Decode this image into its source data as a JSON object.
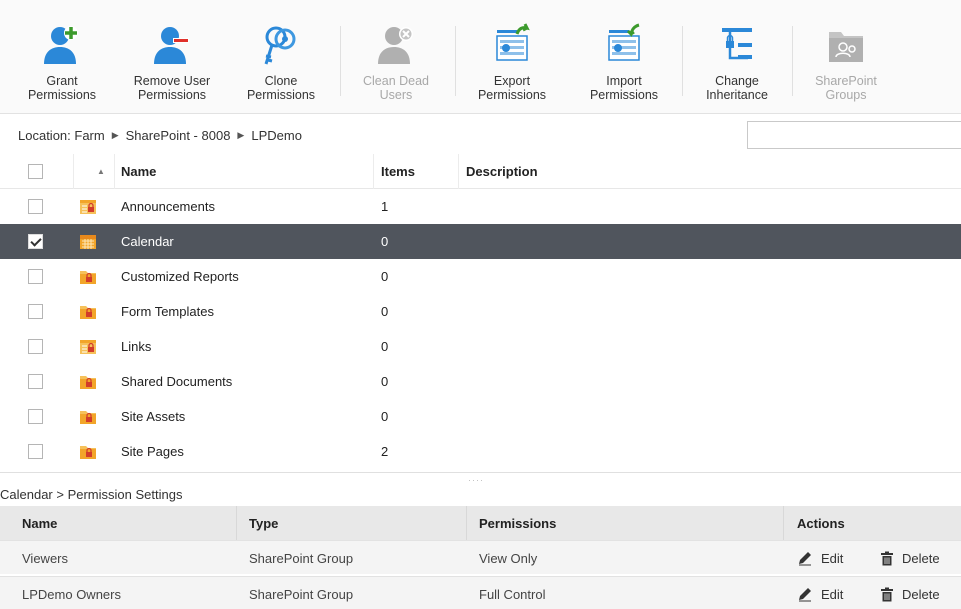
{
  "toolbar": {
    "buttons": [
      {
        "label": "Grant\nPermissions",
        "icon": "user-add-icon",
        "enabled": true
      },
      {
        "label": "Remove User\nPermissions",
        "icon": "user-remove-icon",
        "enabled": true
      },
      {
        "label": "Clone\nPermissions",
        "icon": "keys-icon",
        "enabled": true
      },
      {
        "label": "Clean Dead\nUsers",
        "icon": "user-clean-icon",
        "enabled": false
      },
      {
        "label": "Export\nPermissions",
        "icon": "export-icon",
        "enabled": true
      },
      {
        "label": "Import\nPermissions",
        "icon": "import-icon",
        "enabled": true
      },
      {
        "label": "Change\nInheritance",
        "icon": "inheritance-icon",
        "enabled": true
      },
      {
        "label": "SharePoint\nGroups",
        "icon": "sharepoint-groups-icon",
        "enabled": false
      }
    ]
  },
  "location": {
    "prefix": "Location: Farm",
    "crumbs": [
      "SharePoint - 8008",
      "LPDemo"
    ],
    "arrow": "▶"
  },
  "search": {
    "placeholder": "",
    "value": ""
  },
  "grid": {
    "sort_indicator": "▲",
    "columns": {
      "name": "Name",
      "items": "Items",
      "description": "Description"
    },
    "rows": [
      {
        "name": "Announcements",
        "items": "1",
        "description": "",
        "icon": "list-lock-icon",
        "checked": false,
        "selected": false
      },
      {
        "name": "Calendar",
        "items": "0",
        "description": "",
        "icon": "calendar-list-icon",
        "checked": true,
        "selected": true
      },
      {
        "name": "Customized Reports",
        "items": "0",
        "description": "",
        "icon": "library-lock-icon",
        "checked": false,
        "selected": false
      },
      {
        "name": "Form Templates",
        "items": "0",
        "description": "",
        "icon": "library-lock-icon",
        "checked": false,
        "selected": false
      },
      {
        "name": "Links",
        "items": "0",
        "description": "",
        "icon": "list-lock-icon",
        "checked": false,
        "selected": false
      },
      {
        "name": "Shared Documents",
        "items": "0",
        "description": "",
        "icon": "library-lock-icon",
        "checked": false,
        "selected": false
      },
      {
        "name": "Site Assets",
        "items": "0",
        "description": "",
        "icon": "library-lock-icon",
        "checked": false,
        "selected": false
      },
      {
        "name": "Site Pages",
        "items": "2",
        "description": "",
        "icon": "library-lock-icon",
        "checked": false,
        "selected": false
      }
    ]
  },
  "splitter": {
    "grip": "····"
  },
  "permissions": {
    "title": "Calendar > Permission Settings",
    "columns": {
      "name": "Name",
      "type": "Type",
      "permissions": "Permissions",
      "actions": "Actions"
    },
    "edit_label": "Edit",
    "delete_label": "Delete",
    "rows": [
      {
        "name": "Viewers",
        "type": "SharePoint Group",
        "permissions": "View Only"
      },
      {
        "name": "LPDemo Owners",
        "type": "SharePoint Group",
        "permissions": "Full Control"
      }
    ]
  },
  "colors": {
    "selected_row": "#50555d",
    "icon_blue": "#2b88d8",
    "icon_red": "#e0302a",
    "icon_green": "#3c9a2c",
    "folder_orange": "#f2a52a",
    "disabled_gray": "#b0b0b0"
  }
}
